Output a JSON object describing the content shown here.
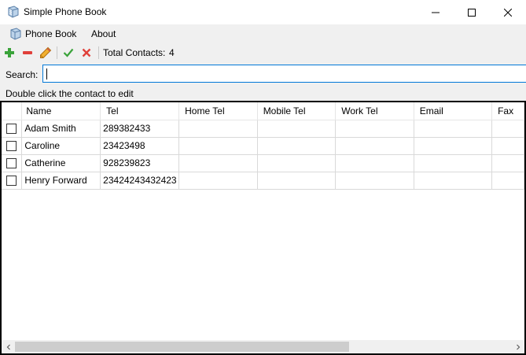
{
  "window": {
    "title": "Simple Phone Book",
    "icon": "phonebook-icon"
  },
  "menu": {
    "items": [
      {
        "label": "Phone Book",
        "icon": "phonebook-icon"
      },
      {
        "label": "About"
      }
    ]
  },
  "toolbar": {
    "buttons": [
      {
        "icon": "add-icon",
        "color": "#3aa33a"
      },
      {
        "icon": "remove-icon",
        "color": "#e0403a"
      },
      {
        "icon": "pencil-icon",
        "color": "#e8a020"
      },
      {
        "icon": "check-icon",
        "color": "#3aa33a"
      },
      {
        "icon": "cross-icon",
        "color": "#e0403a"
      }
    ],
    "total_label": "Total Contacts:",
    "total_count": "4"
  },
  "search": {
    "label": "Search:",
    "value": ""
  },
  "hint": "Double click the contact to edit",
  "grid": {
    "columns": [
      "Name",
      "Tel",
      "Home Tel",
      "Mobile Tel",
      "Work Tel",
      "Email",
      "Fax"
    ],
    "rows": [
      {
        "checked": false,
        "name": "Adam Smith",
        "tel": "289382433",
        "home": "",
        "mobile": "",
        "work": "",
        "email": "",
        "fax": ""
      },
      {
        "checked": false,
        "name": "Caroline",
        "tel": "23423498",
        "home": "",
        "mobile": "",
        "work": "",
        "email": "",
        "fax": ""
      },
      {
        "checked": false,
        "name": "Catherine",
        "tel": "928239823",
        "home": "",
        "mobile": "",
        "work": "",
        "email": "",
        "fax": ""
      },
      {
        "checked": false,
        "name": "Henry Forward",
        "tel": "23424243432423",
        "home": "",
        "mobile": "",
        "work": "",
        "email": "",
        "fax": ""
      }
    ]
  }
}
